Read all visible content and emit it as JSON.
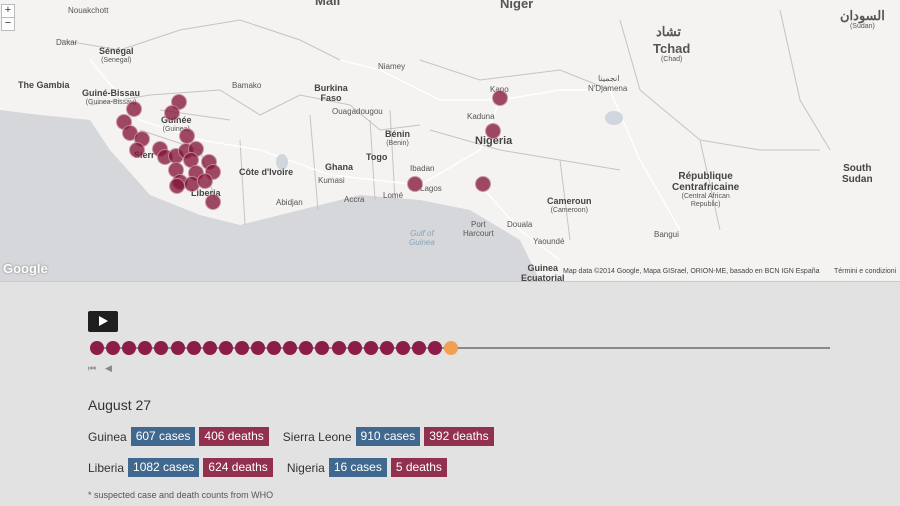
{
  "map": {
    "zoom_in": "+",
    "zoom_out": "−",
    "google": "Google",
    "attribution": "Map data ©2014 Google, Mapa GISrael, ORION-ME, basado en BCN IGN España",
    "terms": "Términi e condizioni",
    "labels": {
      "mali": "Mali",
      "niger": "Niger",
      "chad_ar": "تشاد",
      "chad": "Tchad",
      "chad_sub": "(Chad)",
      "sudan_ar": "السودان",
      "sudan_sub": "(Sudan)",
      "nouakchott": "Nouakchott",
      "dakar": "Dakar",
      "senegal": "Sénégal",
      "senegal_sub": "(Senegal)",
      "gambia": "The Gambia",
      "guinea_bissau": "Guiné-Bissau",
      "guinea_bissau_sub": "(Guinea-Bissau)",
      "guinee": "Guinée",
      "guinee_sub": "(Guinea)",
      "bamako": "Bamako",
      "niamey": "Niamey",
      "burkina": "Burkina Faso",
      "ouaga": "Ouagadougou",
      "kano": "Kano",
      "kaduna": "Kaduna",
      "nigeria": "Nigeria",
      "ndjamena_ar": "انجمينا",
      "ndjamena": "N'Djamena",
      "benin": "Bénin",
      "benin_sub": "(Benin)",
      "cote": "Côte d'Ivoire",
      "ghana": "Ghana",
      "togo": "Togo",
      "kumasi": "Kumasi",
      "accra": "Accra",
      "abidjan": "Abidjan",
      "lome": "Lomé",
      "ibadan": "Ibadan",
      "lagos": "Lagos",
      "liberia": "Liberia",
      "sierra": "Sierr",
      "rca": "République",
      "rca2": "Centrafricaine",
      "rca_sub": "(Central African",
      "rca_sub2": "Republic)",
      "south_sudan": "South",
      "south_sudan2": "Sudan",
      "cameroun": "Cameroun",
      "cameroun_sub": "(Cameroon)",
      "port_harcourt": "Port",
      "port_harcourt2": "Harcourt",
      "douala": "Douala",
      "yaounde": "Yaoundé",
      "bangui": "Bangui",
      "gulf": "Gulf of",
      "gulf2": "Guinea",
      "eq_guinea": "Guinea",
      "eq_guinea2": "Ecuatorial"
    }
  },
  "timeline": {
    "frames": 23,
    "current_frame": 23,
    "date": "August 27"
  },
  "stats": {
    "guinea": {
      "country": "Guinea",
      "cases": "607 cases",
      "deaths": "406 deaths"
    },
    "sierra_leone": {
      "country": "Sierra Leone",
      "cases": "910 cases",
      "deaths": "392 deaths"
    },
    "liberia": {
      "country": "Liberia",
      "cases": "1082 cases",
      "deaths": "624 deaths"
    },
    "nigeria": {
      "country": "Nigeria",
      "cases": "16 cases",
      "deaths": "5 deaths"
    }
  },
  "footnote": "* suspected case and death counts from WHO",
  "colors": {
    "marker": "#84163a",
    "timeline_dot": "#8b1d48",
    "timeline_current": "#f0a050",
    "cases_badge": "#41688f",
    "deaths_badge": "#92304f"
  }
}
